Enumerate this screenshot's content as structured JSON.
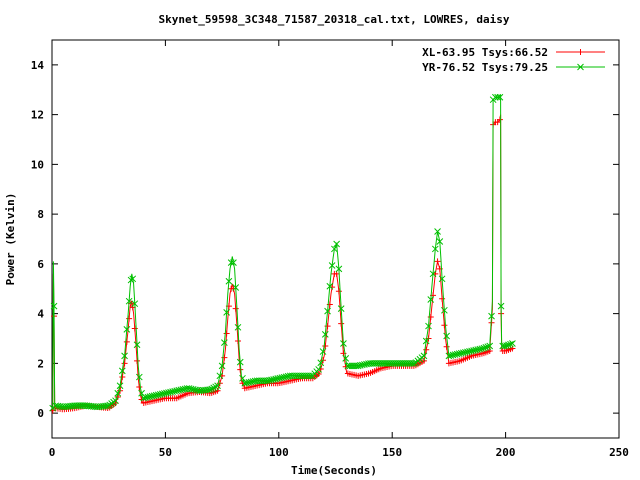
{
  "chart_data": {
    "type": "line",
    "title": "Skynet_59598_3C348_71587_20318_cal.txt, LOWRES, daisy",
    "xlabel": "Time(Seconds)",
    "ylabel": "Power (Kelvin)",
    "xlim": [
      0,
      250
    ],
    "ylim": [
      -1,
      15
    ],
    "x_ticks": [
      0,
      50,
      100,
      150,
      200,
      250
    ],
    "y_ticks": [
      0,
      2,
      4,
      6,
      8,
      10,
      12,
      14
    ],
    "x_tick_labels": [
      "0",
      "50",
      "100",
      "150",
      "200",
      "250"
    ],
    "y_tick_labels": [
      "0",
      "2",
      "4",
      "6",
      "8",
      "10",
      "12",
      "14"
    ],
    "grid": false,
    "legend_position": "top-right",
    "series": [
      {
        "name": "XL-63.95 Tsys:66.52",
        "color": "#ff0000",
        "marker": "plus",
        "points": [
          [
            0.3,
            0.1
          ],
          [
            0.6,
            5.6
          ],
          [
            0.9,
            3.9
          ],
          [
            1.2,
            0.2
          ],
          [
            5,
            0.15
          ],
          [
            10,
            0.2
          ],
          [
            15,
            0.3
          ],
          [
            20,
            0.25
          ],
          [
            25,
            0.2
          ],
          [
            28,
            0.4
          ],
          [
            30,
            0.9
          ],
          [
            32,
            2.0
          ],
          [
            33.5,
            3.3
          ],
          [
            34.5,
            4.3
          ],
          [
            35.2,
            4.5
          ],
          [
            36,
            4.0
          ],
          [
            37,
            2.8
          ],
          [
            38,
            1.4
          ],
          [
            39,
            0.7
          ],
          [
            40,
            0.4
          ],
          [
            45,
            0.5
          ],
          [
            50,
            0.6
          ],
          [
            55,
            0.6
          ],
          [
            60,
            0.8
          ],
          [
            65,
            0.85
          ],
          [
            70,
            0.8
          ],
          [
            73,
            0.9
          ],
          [
            75,
            1.5
          ],
          [
            76.5,
            2.6
          ],
          [
            77.5,
            3.8
          ],
          [
            78.5,
            4.8
          ],
          [
            79.5,
            5.2
          ],
          [
            80.5,
            4.8
          ],
          [
            81.5,
            3.6
          ],
          [
            82.5,
            2.2
          ],
          [
            83.5,
            1.3
          ],
          [
            85,
            1.0
          ],
          [
            90,
            1.1
          ],
          [
            95,
            1.2
          ],
          [
            100,
            1.2
          ],
          [
            105,
            1.3
          ],
          [
            110,
            1.4
          ],
          [
            115,
            1.4
          ],
          [
            118,
            1.6
          ],
          [
            120,
            2.3
          ],
          [
            121.5,
            3.5
          ],
          [
            123,
            4.8
          ],
          [
            124.5,
            5.6
          ],
          [
            125.5,
            5.6
          ],
          [
            126.5,
            4.9
          ],
          [
            127.5,
            3.6
          ],
          [
            128.5,
            2.4
          ],
          [
            130,
            1.6
          ],
          [
            135,
            1.5
          ],
          [
            140,
            1.6
          ],
          [
            145,
            1.8
          ],
          [
            150,
            1.9
          ],
          [
            155,
            1.9
          ],
          [
            160,
            1.9
          ],
          [
            164,
            2.1
          ],
          [
            166,
            3.0
          ],
          [
            167.5,
            4.3
          ],
          [
            169,
            5.6
          ],
          [
            170,
            6.1
          ],
          [
            171,
            5.8
          ],
          [
            172,
            4.6
          ],
          [
            173.5,
            3.0
          ],
          [
            175,
            2.0
          ],
          [
            180,
            2.1
          ],
          [
            185,
            2.3
          ],
          [
            190,
            2.4
          ],
          [
            193,
            2.5
          ],
          [
            194.2,
            4.2
          ],
          [
            194.5,
            11.6
          ],
          [
            195.5,
            11.7
          ],
          [
            196.5,
            11.7
          ],
          [
            197.5,
            11.8
          ],
          [
            197.8,
            12.0
          ],
          [
            198,
            4.0
          ],
          [
            198.3,
            2.5
          ],
          [
            200,
            2.5
          ],
          [
            203,
            2.6
          ]
        ]
      },
      {
        "name": "YR-76.52 Tsys:79.25",
        "color": "#00c000",
        "marker": "cross",
        "points": [
          [
            0.3,
            0.2
          ],
          [
            0.6,
            6.1
          ],
          [
            0.9,
            4.3
          ],
          [
            1.2,
            0.3
          ],
          [
            5,
            0.25
          ],
          [
            10,
            0.3
          ],
          [
            15,
            0.3
          ],
          [
            20,
            0.25
          ],
          [
            25,
            0.3
          ],
          [
            28,
            0.5
          ],
          [
            30,
            1.1
          ],
          [
            32,
            2.3
          ],
          [
            33.5,
            3.9
          ],
          [
            34.5,
            5.1
          ],
          [
            35.2,
            5.6
          ],
          [
            36,
            5.2
          ],
          [
            37,
            3.6
          ],
          [
            38,
            1.9
          ],
          [
            39,
            1.0
          ],
          [
            40,
            0.6
          ],
          [
            45,
            0.7
          ],
          [
            50,
            0.8
          ],
          [
            55,
            0.9
          ],
          [
            60,
            1.0
          ],
          [
            65,
            0.9
          ],
          [
            70,
            0.95
          ],
          [
            73,
            1.1
          ],
          [
            75,
            1.9
          ],
          [
            76.5,
            3.3
          ],
          [
            77.5,
            4.8
          ],
          [
            78.5,
            5.8
          ],
          [
            79.5,
            6.3
          ],
          [
            80.5,
            5.8
          ],
          [
            81.5,
            4.3
          ],
          [
            82.5,
            2.6
          ],
          [
            83.5,
            1.5
          ],
          [
            85,
            1.2
          ],
          [
            90,
            1.3
          ],
          [
            95,
            1.3
          ],
          [
            100,
            1.4
          ],
          [
            105,
            1.5
          ],
          [
            110,
            1.5
          ],
          [
            115,
            1.5
          ],
          [
            118,
            1.8
          ],
          [
            120,
            2.7
          ],
          [
            121.5,
            4.1
          ],
          [
            123,
            5.6
          ],
          [
            124.5,
            6.6
          ],
          [
            125.5,
            6.8
          ],
          [
            126.5,
            5.8
          ],
          [
            127.5,
            4.2
          ],
          [
            128.5,
            2.8
          ],
          [
            130,
            1.9
          ],
          [
            135,
            1.9
          ],
          [
            140,
            2.0
          ],
          [
            145,
            2.0
          ],
          [
            150,
            2.0
          ],
          [
            155,
            2.0
          ],
          [
            160,
            2.0
          ],
          [
            164,
            2.3
          ],
          [
            166,
            3.5
          ],
          [
            167.5,
            5.1
          ],
          [
            169,
            6.6
          ],
          [
            170,
            7.3
          ],
          [
            171,
            6.9
          ],
          [
            172,
            5.4
          ],
          [
            173.5,
            3.5
          ],
          [
            175,
            2.3
          ],
          [
            180,
            2.4
          ],
          [
            185,
            2.5
          ],
          [
            190,
            2.6
          ],
          [
            193,
            2.7
          ],
          [
            194.2,
            4.5
          ],
          [
            194.5,
            12.6
          ],
          [
            195.5,
            12.7
          ],
          [
            196.5,
            12.7
          ],
          [
            197.5,
            12.7
          ],
          [
            197.8,
            12.8
          ],
          [
            198,
            4.3
          ],
          [
            198.3,
            2.7
          ],
          [
            200,
            2.7
          ],
          [
            203,
            2.8
          ]
        ]
      }
    ]
  }
}
